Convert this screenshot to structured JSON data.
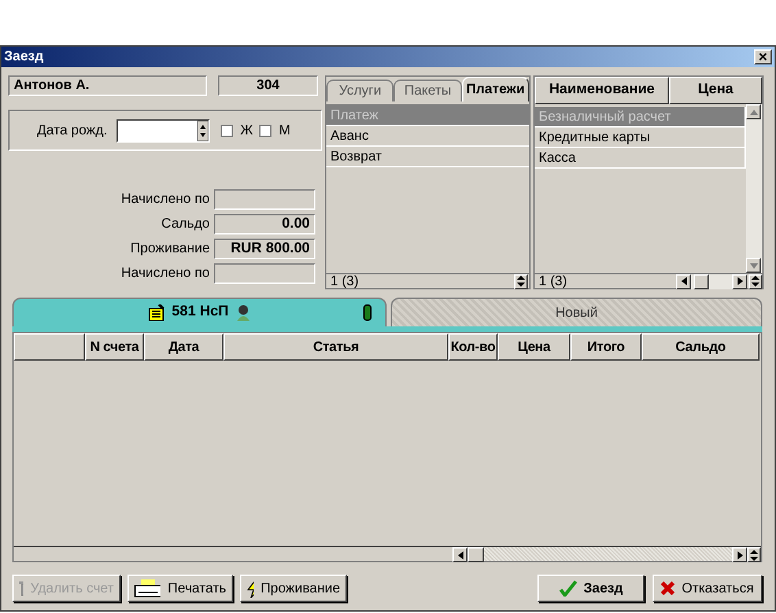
{
  "window": {
    "title": "Заезд",
    "close": "×"
  },
  "guest": {
    "name": "Антонов А.",
    "room": "304",
    "dob_label": "Дата рожд.",
    "genders": [
      {
        "label": "Ж",
        "checked": false
      },
      {
        "label": "М",
        "checked": false
      }
    ],
    "fields": [
      {
        "label": "Начислено по"
      },
      {
        "label": "Сальдо",
        "value": "0.00"
      },
      {
        "label": "Проживание",
        "value": "RUR 800.00"
      },
      {
        "label": "Начислено по"
      }
    ]
  },
  "services": {
    "tabs": [
      {
        "label": "Услуги",
        "selected": false
      },
      {
        "label": "Пакеты",
        "selected": false
      },
      {
        "label": "Платежи",
        "selected": true
      }
    ],
    "rows": [
      {
        "label": "Платеж",
        "selected": true
      },
      {
        "label": "Аванс",
        "selected": false
      },
      {
        "label": "Возврат",
        "selected": false
      }
    ],
    "footer": "1 (3)"
  },
  "items": {
    "columns": [
      "Наименование",
      "Цена"
    ],
    "rows": [
      {
        "name": "Безналичный расчет",
        "selected": true
      },
      {
        "name": "Кредитные карты",
        "selected": false
      },
      {
        "name": "Касса",
        "selected": false
      }
    ],
    "footer": "1 (3)"
  },
  "account_tabs": [
    {
      "label": "581 НсП",
      "selected": true
    },
    {
      "label": "Новый",
      "selected": false
    }
  ],
  "table": {
    "columns": [
      "N счета",
      "Дата",
      "Статья",
      "Кол-во",
      "Цена",
      "Итого",
      "Сальдо"
    ]
  },
  "left_buttons": [
    {
      "label": "Удалить счет",
      "kind": "delete",
      "disabled": true
    },
    {
      "label": "Печатать",
      "kind": "print",
      "disabled": false
    },
    {
      "label": "Проживание",
      "kind": "stay",
      "disabled": false
    }
  ],
  "right_buttons": [
    {
      "label": "Заезд",
      "kind": "confirm",
      "disabled": false
    },
    {
      "label": "Отказаться",
      "kind": "cancel",
      "disabled": false
    }
  ]
}
